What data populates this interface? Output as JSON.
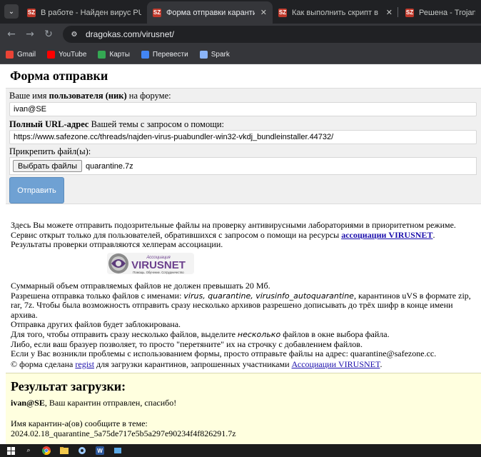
{
  "tabs": [
    {
      "favicon": "SZ",
      "title": "В работе - Найден вирус PUABun"
    },
    {
      "favicon": "SZ",
      "title": "Форма отправки карантина"
    },
    {
      "favicon": "SZ",
      "title": "Как выполнить скрипт в AVZ | B"
    },
    {
      "favicon": "SZ",
      "title": "Решена - Trojan bladabindi"
    }
  ],
  "toolbar": {
    "url": "dragokas.com/virusnet/"
  },
  "bookmarks": [
    {
      "label": "Gmail",
      "icon_color": "#ea4335"
    },
    {
      "label": "YouTube",
      "icon_color": "#ff0000"
    },
    {
      "label": "Карты",
      "icon_color": "#34a853"
    },
    {
      "label": "Перевести",
      "icon_color": "#4285f4"
    },
    {
      "label": "Spark",
      "icon_color": "#8ab4f8"
    }
  ],
  "form": {
    "title": "Форма отправки",
    "username_label_pre": "Ваше имя ",
    "username_label_bold": "пользователя (ник)",
    "username_label_post": " на форуме:",
    "username_value": "ivan@SE",
    "url_label_bold": "Полный URL-адрес",
    "url_label_post": " Вашей темы с запросом о помощи:",
    "url_value": "https://www.safezone.cc/threads/najden-virus-puabundler-win32-vkdj_bundleinstaller.44732/",
    "file_label": "Прикрепить файл(ы):",
    "file_button": "Выбрать файлы",
    "file_name": "quarantine.7z",
    "submit": "Отправить"
  },
  "info": {
    "l1": "Здесь Вы можете отправить подозрительные файлы на проверку антивирусными лабораториями в приоритетном режиме.",
    "l2_pre": "Сервис открыт только для пользователей, обратившихся с запросом о помощи на ресурсы ",
    "l2_link": "ассоциации VIRUSNET",
    "l2_post": ".",
    "l3": "Результаты проверки отправляются хелперам ассоциации.",
    "logo_caption": "Ассоциация",
    "logo_name": "VIRUSNET",
    "logo_slogan": "Помощь. Обучение. Сотрудничество",
    "s1": "Суммарный объем отправляемых файлов не должен превышать 20 Мб.",
    "s2_pre": "Разрешена отправка только файлов с именами: ",
    "s2_names": "virus, quarantine, virusinfo_autoquarantine",
    "s2_post": ", карантинов uVS в формате zip, rar, 7z. Чтобы была возможность отправить сразу несколько архивов разрешено дописывать до трёх шифр в конце имени архива.",
    "s3": "Отправка других файлов будет заблокирована.",
    "s4_pre": "Для того, чтобы отправить сразу несколько файлов, выделите ",
    "s4_em": "несколько",
    "s4_post": " файлов в окне выбора файла.",
    "s5": "Либо, если ваш бразуер позволяет, то просто \"перетяните\" их на строчку с добавлением файлов.",
    "s6": "Если у Вас возникли проблемы с использованием формы, просто отправьте файлы на адрес: quarantine@safezone.cc.",
    "credit_pre": "© форма сделана ",
    "credit_link1": "regist",
    "credit_mid": " для загрузки карантинов, запрошенных участниками ",
    "credit_link2": "Ассоциации VIRUSNET",
    "credit_post": "."
  },
  "result": {
    "title": "Результат загрузки:",
    "user": "ivan@SE",
    "message": ", Ваш карантин отправлен, спасибо!",
    "name_label": "Имя карантин-а(ов) сообщите в теме:",
    "name_value": "2024.02.18_quarantine_5a75de717e5b5a297e90234f4f826291.7z"
  }
}
